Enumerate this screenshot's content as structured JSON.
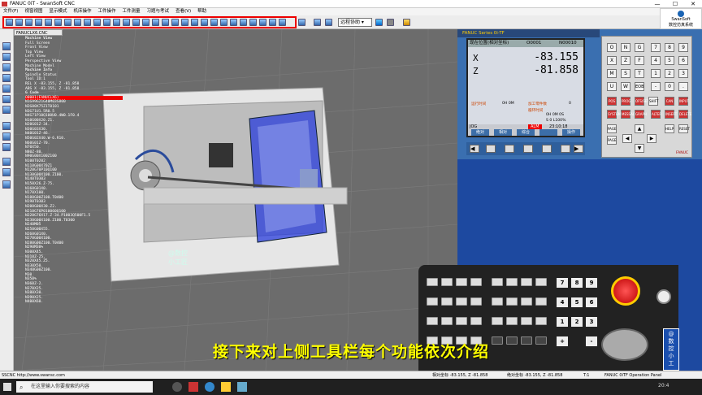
{
  "window": {
    "title": "FANUC 0iT - SwanSoft CNC",
    "min": "—",
    "max": "☐",
    "close": "✕"
  },
  "menu": [
    "文件(F)",
    "视窗视图",
    "显示模式",
    "机床操作",
    "工件操作",
    "工件测量",
    "习题与考试",
    "查看(V)",
    "帮助"
  ],
  "logo": {
    "line1": "SwanSoft",
    "line2": "数控仿真系统"
  },
  "toolbar": {
    "mode_select": "远程协助"
  },
  "viewport": {
    "tab": "FANUCLX6.CNC",
    "tree": [
      {
        "t": "Machine View",
        "c": "sec"
      },
      {
        "t": "Full Screen",
        "c": ""
      },
      {
        "t": "Front View",
        "c": ""
      },
      {
        "t": "Top View",
        "c": ""
      },
      {
        "t": "Left View",
        "c": ""
      },
      {
        "t": "Perspective View",
        "c": ""
      },
      {
        "t": "Machine Model",
        "c": ""
      },
      {
        "t": "Machine Info",
        "c": "sec"
      },
      {
        "t": "Spindle Status",
        "c": ""
      },
      {
        "t": "Tool ID:1",
        "c": ""
      },
      {
        "t": "REL X -83.155, Z -81.858",
        "c": ""
      },
      {
        "t": "ABS X -83.155, Z -81.858",
        "c": ""
      },
      {
        "t": "G Code",
        "c": "sec"
      },
      {
        "t": "O0001(FANUCLX6)",
        "c": "hl"
      },
      {
        "t": "N1G99G21G40M03S800",
        "c": ""
      },
      {
        "t": "N2G00X75Z1T0101",
        "c": ""
      },
      {
        "t": "N3G71U1.5R0.5",
        "c": ""
      },
      {
        "t": "N4G71P10Q100U0.4W0.1F0.4",
        "c": ""
      },
      {
        "t": "N10G00X20.Z1.",
        "c": ""
      },
      {
        "t": "N20G01Z-34.",
        "c": ""
      },
      {
        "t": "N30G03X30.",
        "c": ""
      },
      {
        "t": "N40G01Z-46.",
        "c": ""
      },
      {
        "t": "N50G02X40.W-6.R10.",
        "c": ""
      },
      {
        "t": "N60G01Z-70.",
        "c": ""
      },
      {
        "t": "N70X50.",
        "c": ""
      },
      {
        "t": "N80Z-80.",
        "c": ""
      },
      {
        "t": "N90G00X100Z100",
        "c": ""
      },
      {
        "t": "N100T0202",
        "c": ""
      },
      {
        "t": "N110G00X70Z1",
        "c": ""
      },
      {
        "t": "N120G70P10Q100",
        "c": ""
      },
      {
        "t": "N130G00X100.Z100.",
        "c": ""
      },
      {
        "t": "N140T0303",
        "c": ""
      },
      {
        "t": "N150X26.Z-75.",
        "c": ""
      },
      {
        "t": "N160G01X0.",
        "c": ""
      },
      {
        "t": "N170X100.",
        "c": ""
      },
      {
        "t": "N180G00Z100.T0400",
        "c": ""
      },
      {
        "t": "N190T0303",
        "c": ""
      },
      {
        "t": "N200G00X30.Z2.",
        "c": ""
      },
      {
        "t": "N210G76P010060Q100",
        "c": ""
      },
      {
        "t": "N220G76X17.Z-34.P1003Q500F1.5",
        "c": ""
      },
      {
        "t": "N230G00X100.Z100.T0300",
        "c": ""
      },
      {
        "t": "N240M05",
        "c": ""
      },
      {
        "t": "N250G00X55.",
        "c": ""
      },
      {
        "t": "N260G01X0.",
        "c": ""
      },
      {
        "t": "N270G00X100.",
        "c": ""
      },
      {
        "t": "N280G00Z100.T0400",
        "c": ""
      },
      {
        "t": "N290M30%",
        "c": ""
      },
      {
        "t": "N300X45.",
        "c": ""
      },
      {
        "t": "N310Z-25.",
        "c": ""
      },
      {
        "t": "N320X45.Z5.",
        "c": ""
      },
      {
        "t": "N330X50.",
        "c": ""
      },
      {
        "t": "N340G00Z100.",
        "c": ""
      },
      {
        "t": "M30",
        "c": ""
      },
      {
        "t": "N350%",
        "c": ""
      },
      {
        "t": "N360Z-2.",
        "c": ""
      },
      {
        "t": "N370X25.",
        "c": ""
      },
      {
        "t": "N380X30.",
        "c": ""
      },
      {
        "t": "N390X25.",
        "c": ""
      },
      {
        "t": "N400X60.",
        "c": ""
      }
    ],
    "watermark": {
      "l1": "@数控",
      "l2": "小工匠"
    }
  },
  "cnc": {
    "series": "FANUC Series 0i-TF",
    "screen_title": "现在位置(相对坐标)",
    "prog_no": "O0001",
    "seq_no": "N00010",
    "axes": [
      {
        "label": "X",
        "value": "-83.155"
      },
      {
        "label": "Z",
        "value": "-81.858"
      }
    ],
    "info": {
      "l1": "运行时间",
      "v1": "0H 0M",
      "l2": "加工零件数",
      "v2": "0",
      "l3": "循环时间",
      "v3": "0H 0M 0S",
      "feed": "S 0 L100%"
    },
    "mode": "JOG",
    "alarm": "ALM",
    "time": "23:10:18",
    "softkeys": [
      "绝对",
      "相对",
      "综合",
      "",
      "操作"
    ],
    "brand": "FANUC"
  },
  "keys": [
    [
      "O",
      "N",
      "G",
      "7",
      "8",
      "9"
    ],
    [
      "X",
      "Z",
      "F",
      "4",
      "5",
      "6"
    ],
    [
      "M",
      "S",
      "T",
      "1",
      "2",
      "3"
    ],
    [
      "U",
      "W",
      "EOB",
      "-",
      "0",
      "."
    ]
  ],
  "funckeys": [
    "POS",
    "PROG",
    "OFS/SET",
    "SHIFT",
    "CAN",
    "INPUT",
    "SYSTEM",
    "MESSAGE",
    "GRAPH",
    "ALTER",
    "INSERT",
    "DELETE"
  ],
  "extra_keys": [
    "PAGE",
    "PAGE",
    "HELP",
    "RESET"
  ],
  "oppanel": {
    "nums": [
      "7",
      "8",
      "9",
      "4",
      "5",
      "6",
      "1",
      "2",
      "3"
    ],
    "plus": "+",
    "minus": "-"
  },
  "subtitle": "接下来对上侧工具栏每个功能依次介绍",
  "sidewm": [
    "@",
    "数",
    "控",
    "小",
    "工",
    "匠"
  ],
  "status": {
    "left": "SSCNC http://www.swansc.com",
    "rel": "相对坐标 -83.155, Z -81.858",
    "abs": "绝对坐标 -83.155, Z -81.858",
    "tool": "T:1",
    "panel": "FANUC 0iTF Operation Panel"
  },
  "taskbar": {
    "search_placeholder": "在这里输入你要搜索的内容",
    "clock": "20:4"
  }
}
